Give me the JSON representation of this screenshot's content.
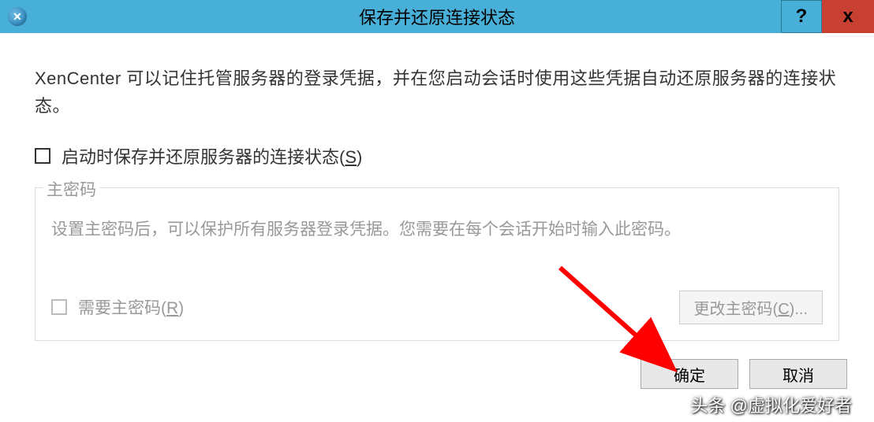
{
  "titlebar": {
    "title": "保存并还原连接状态",
    "help_label": "?",
    "close_label": "x"
  },
  "dialog": {
    "description": "XenCenter 可以记住托管服务器的登录凭据，并在您启动会话时使用这些凭据自动还原服务器的连接状态。",
    "save_restore_checkbox_label": "启动时保存并还原服务器的连接状态(",
    "save_restore_accel": "S",
    "save_restore_suffix": ")"
  },
  "master_password": {
    "legend": "主密码",
    "description": "设置主密码后，可以保护所有服务器登录凭据。您需要在每个会话开始时输入此密码。",
    "require_label": "需要主密码(",
    "require_accel": "R",
    "require_suffix": ")",
    "change_button": "更改主密码(",
    "change_accel": "C",
    "change_suffix": ")..."
  },
  "buttons": {
    "ok": "确定",
    "cancel": "取消"
  },
  "watermark": "头条 @虚拟化爱好者"
}
